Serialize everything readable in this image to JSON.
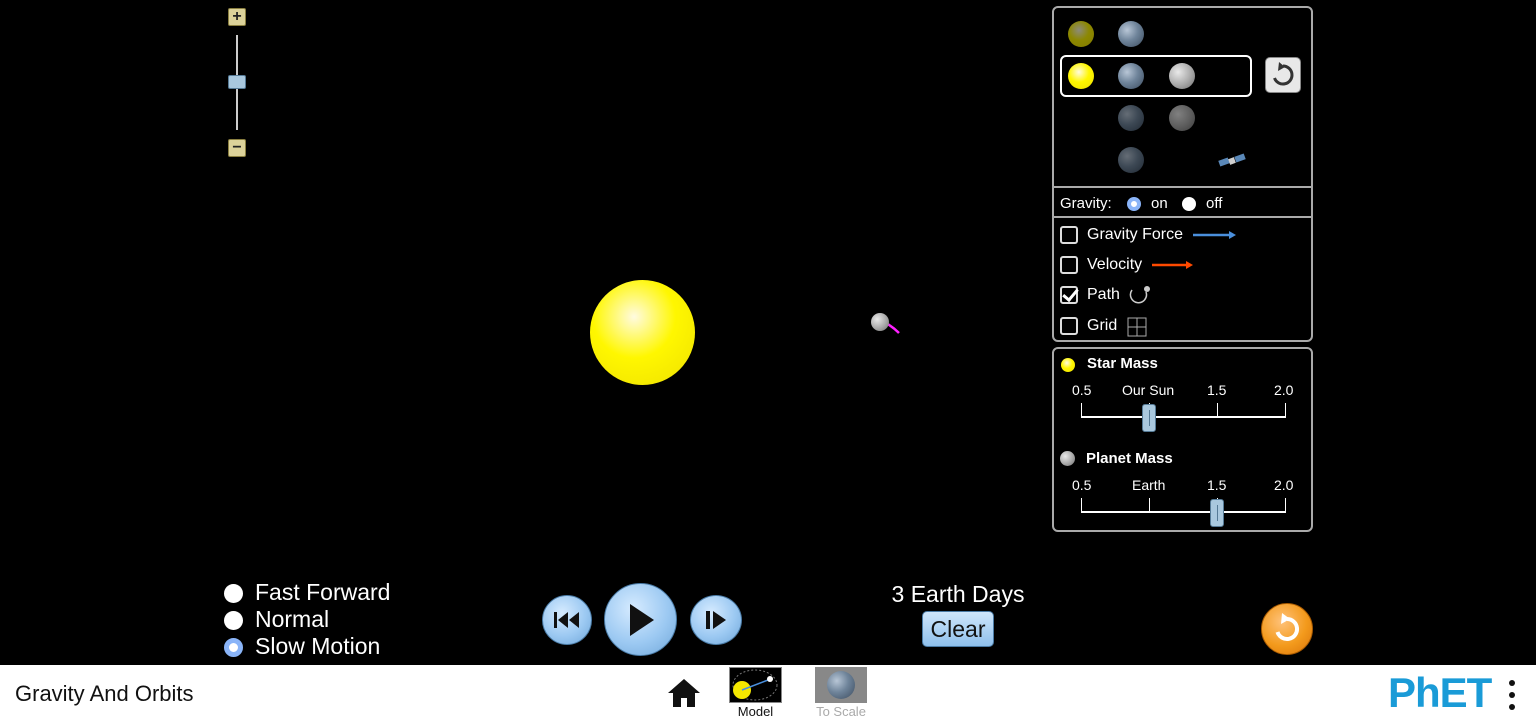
{
  "zoom": {
    "plus": "+",
    "minus": "−"
  },
  "body_selector": {
    "reset_icon": "reset-arrow-icon"
  },
  "gravity": {
    "label": "Gravity:",
    "on": "on",
    "off": "off",
    "selected": "on"
  },
  "checkboxes": [
    {
      "label": "Gravity Force",
      "checked": false,
      "color": "#4a8fdc"
    },
    {
      "label": "Velocity",
      "checked": false,
      "color": "#ff4a00"
    },
    {
      "label": "Path",
      "checked": true
    },
    {
      "label": "Grid",
      "checked": false
    }
  ],
  "mass": {
    "star": {
      "title": "Star Mass",
      "ticks": [
        "0.5",
        "Our Sun",
        "1.5",
        "2.0"
      ],
      "value": 1.0
    },
    "planet": {
      "title": "Planet Mass",
      "ticks": [
        "0.5",
        "Earth",
        "1.5",
        "2.0"
      ],
      "value": 1.5
    }
  },
  "speed": {
    "options": [
      "Fast Forward",
      "Normal",
      "Slow Motion"
    ],
    "selected": "Slow Motion"
  },
  "time": {
    "readout": "3 Earth Days",
    "clear_label": "Clear"
  },
  "navbar": {
    "title": "Gravity And Orbits",
    "screens": [
      "Model",
      "To Scale"
    ],
    "selected_screen": "Model",
    "brand": "PhET",
    "colors": {
      "accent": "#1a9bd7",
      "brand_e": "#f3a20c"
    }
  }
}
